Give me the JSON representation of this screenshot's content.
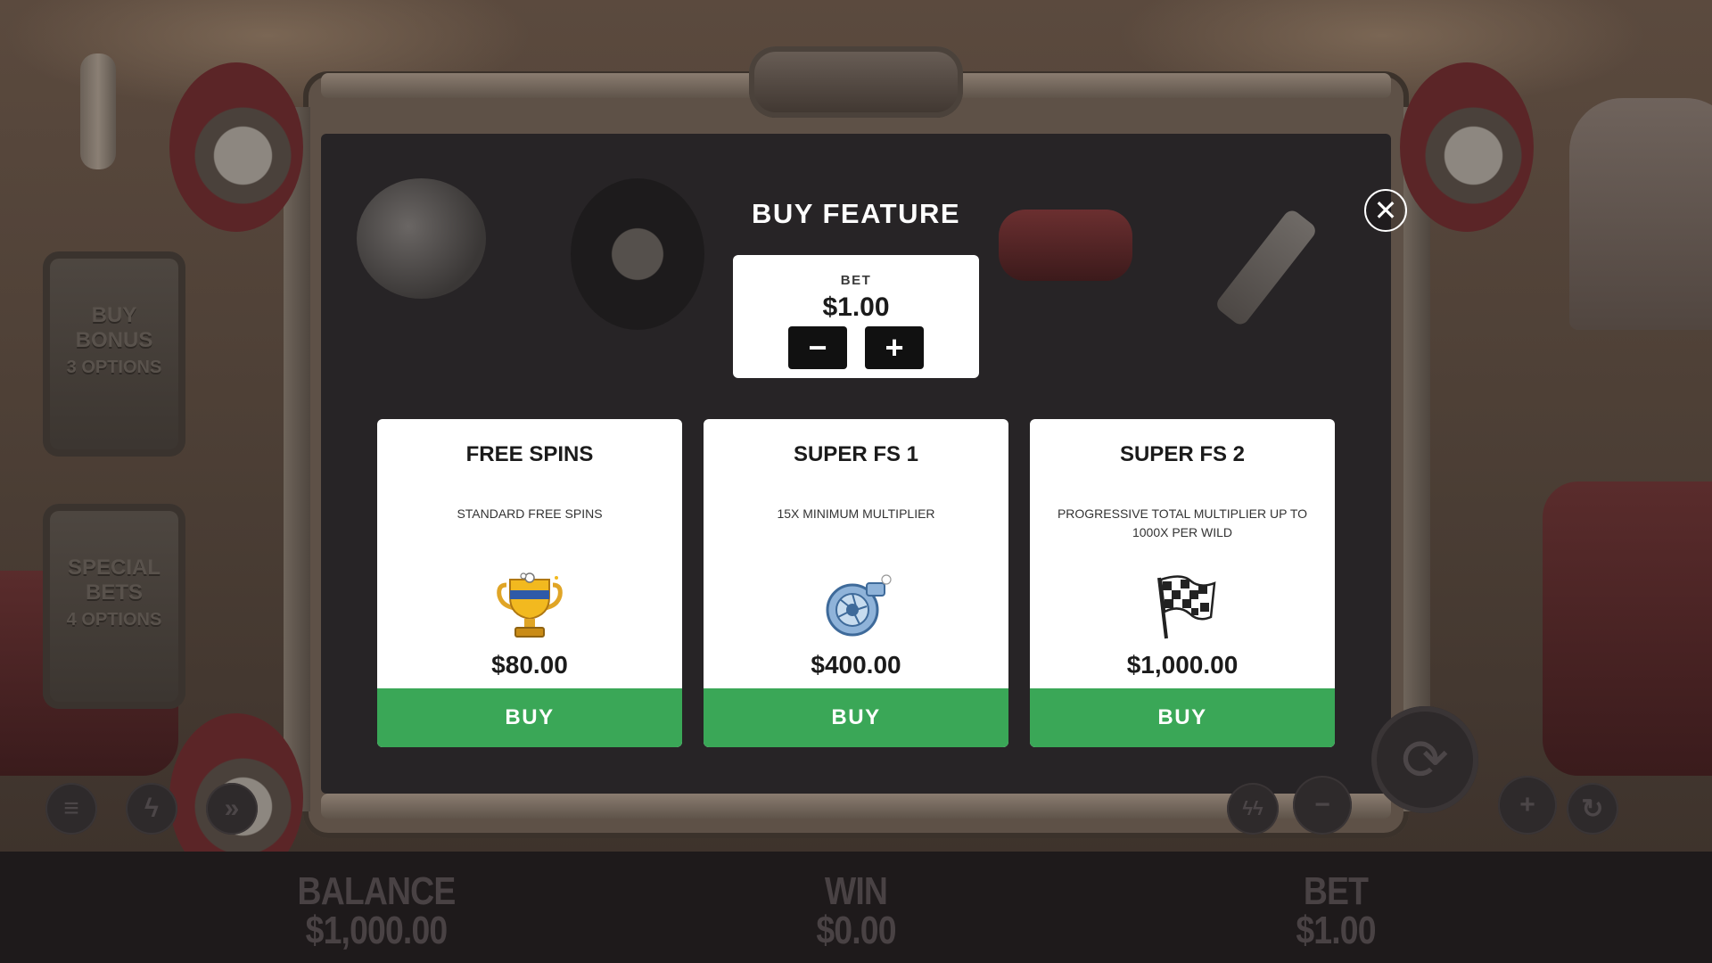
{
  "modal": {
    "title": "BUY FEATURE",
    "close_glyph": "✕",
    "bet": {
      "label": "BET",
      "value": "$1.00",
      "minus_glyph": "−",
      "plus_glyph": "+"
    },
    "options": [
      {
        "title": "FREE SPINS",
        "description": "STANDARD FREE SPINS",
        "icon": "trophy-icon",
        "price": "$80.00",
        "buy_label": "BUY"
      },
      {
        "title": "SUPER FS 1",
        "description": "15X MINIMUM MULTIPLIER",
        "icon": "turbo-icon",
        "price": "$400.00",
        "buy_label": "BUY"
      },
      {
        "title": "SUPER FS 2",
        "description": "PROGRESSIVE TOTAL MULTIPLIER UP TO 1000X PER WILD",
        "icon": "checkered-flag-icon",
        "price": "$1,000.00",
        "buy_label": "BUY"
      }
    ],
    "buy_color": "#3aa757"
  },
  "side_panels": {
    "buy_bonus": [
      "BUY",
      "BONUS",
      "3 OPTIONS"
    ],
    "special_bets": [
      "SPECIAL",
      "BETS",
      "4 OPTIONS"
    ]
  },
  "hud": {
    "balance_label": "BALANCE",
    "balance_value": "$1,000.00",
    "win_label": "WIN",
    "win_value": "$0.00",
    "bet_label": "BET",
    "bet_value": "$1.00"
  },
  "controls": {
    "menu_glyph": "≡",
    "turbo_glyph": "ϟ",
    "fast_glyph": "»",
    "auto_glyph": "ϟϟ",
    "minus_glyph": "−",
    "spin_glyph": "⟳",
    "plus_glyph": "+",
    "autoplay_glyph": "↻"
  }
}
